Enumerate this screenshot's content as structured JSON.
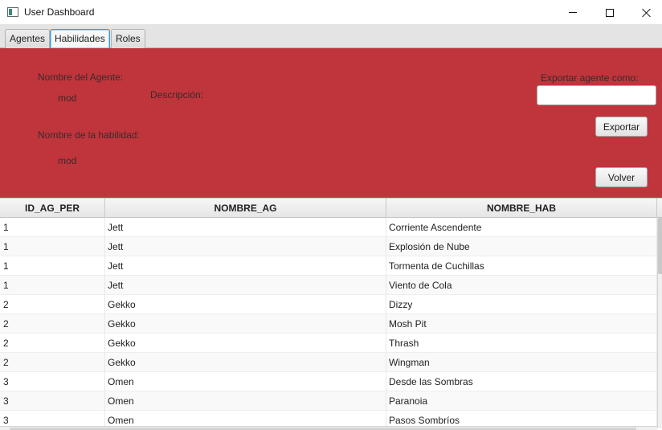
{
  "window": {
    "title": "User Dashboard"
  },
  "tabs": [
    {
      "label": "Agentes"
    },
    {
      "label": "Habilidades",
      "active": true
    },
    {
      "label": "Roles"
    }
  ],
  "form": {
    "agent_name_label": "Nombre del Agente:",
    "agent_name_value": "mod",
    "description_label": "Descripción:",
    "skill_name_label": "Nombre de la habilidad:",
    "skill_name_value": "mod",
    "export_label": "Exportar agente como:",
    "export_input_value": "",
    "export_button": "Exportar",
    "back_button": "Volver",
    "panel_color": "#c0343c"
  },
  "table": {
    "columns": [
      "ID_AG_PER",
      "NOMBRE_AG",
      "NOMBRE_HAB"
    ],
    "rows": [
      [
        "1",
        "Jett",
        "Corriente Ascendente"
      ],
      [
        "1",
        "Jett",
        "Explosión de Nube"
      ],
      [
        "1",
        "Jett",
        "Tormenta de Cuchillas"
      ],
      [
        "1",
        "Jett",
        "Viento de Cola"
      ],
      [
        "2",
        "Gekko",
        "Dizzy"
      ],
      [
        "2",
        "Gekko",
        "Mosh Pit"
      ],
      [
        "2",
        "Gekko",
        "Thrash"
      ],
      [
        "2",
        "Gekko",
        "Wingman"
      ],
      [
        "3",
        "Omen",
        "Desde las Sombras"
      ],
      [
        "3",
        "Omen",
        "Paranoia"
      ],
      [
        "3",
        "Omen",
        "Pasos Sombríos"
      ]
    ]
  },
  "icons": {
    "app": "app-window-icon",
    "minimize": "minimize-icon",
    "maximize": "maximize-icon",
    "close": "close-icon"
  }
}
